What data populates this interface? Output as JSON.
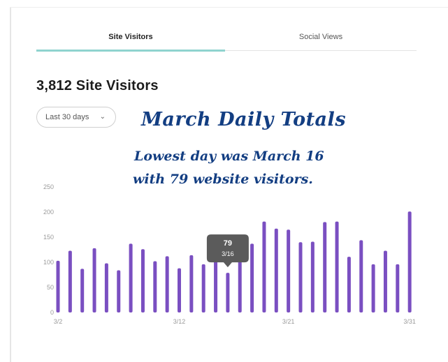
{
  "tabs": [
    {
      "label": "Site Visitors",
      "active": true
    },
    {
      "label": "Social Views",
      "active": false
    }
  ],
  "summary": {
    "count": "3,812",
    "title": "3,812 Site Visitors"
  },
  "range_dropdown": {
    "selected": "Last 30 days",
    "icon": "chevron-down-icon"
  },
  "overlay": {
    "title": "March Daily Totals",
    "line1": "Lowest day was March 16",
    "line2": "with 79 website visitors."
  },
  "colors": {
    "bar": "#7a4fc1",
    "tab_underline": "#8fd3cf",
    "overlay_text": "#133e82",
    "tooltip": "#5b5b5b"
  },
  "tooltip": {
    "value": "79",
    "label": "3/16"
  },
  "chart_data": {
    "type": "bar",
    "ylim": [
      0,
      250
    ],
    "yticks": [
      "0",
      "50",
      "100",
      "150",
      "200",
      "250"
    ],
    "xtick_labels": [
      "3/2",
      "3/12",
      "3/21",
      "3/31"
    ],
    "grid": false,
    "categories": [
      "3/2",
      "3/3",
      "3/4",
      "3/5",
      "3/6",
      "3/7",
      "3/8",
      "3/9",
      "3/10",
      "3/11",
      "3/12",
      "3/13",
      "3/14",
      "3/15",
      "3/16",
      "3/17",
      "3/18",
      "3/19",
      "3/20",
      "3/21",
      "3/22",
      "3/23",
      "3/24",
      "3/25",
      "3/26",
      "3/27",
      "3/28",
      "3/29",
      "3/30",
      "3/31"
    ],
    "values": [
      103,
      123,
      87,
      128,
      98,
      84,
      137,
      126,
      102,
      112,
      88,
      114,
      96,
      105,
      79,
      114,
      137,
      181,
      167,
      165,
      140,
      141,
      180,
      181,
      111,
      144,
      96,
      123,
      96,
      201
    ],
    "highlight_index": 14
  }
}
